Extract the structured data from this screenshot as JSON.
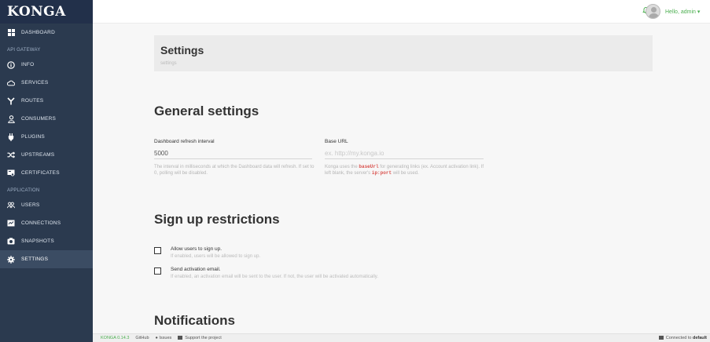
{
  "app": {
    "brand": "KONGA"
  },
  "topbar": {
    "user_label": "Hello, admin ▾"
  },
  "sidebar": {
    "dashboard": "DASHBOARD",
    "section_api": "API GATEWAY",
    "api_items": [
      {
        "label": "INFO",
        "icon": "info-circle-icon"
      },
      {
        "label": "SERVICES",
        "icon": "cloud-icon"
      },
      {
        "label": "ROUTES",
        "icon": "route-fork-icon"
      },
      {
        "label": "CONSUMERS",
        "icon": "user-icon"
      },
      {
        "label": "PLUGINS",
        "icon": "plug-icon"
      },
      {
        "label": "UPSTREAMS",
        "icon": "shuffle-icon"
      },
      {
        "label": "CERTIFICATES",
        "icon": "certificate-icon"
      }
    ],
    "section_app": "APPLICATION",
    "app_items": [
      {
        "label": "USERS",
        "icon": "users-icon"
      },
      {
        "label": "CONNECTIONS",
        "icon": "connection-icon"
      },
      {
        "label": "SNAPSHOTS",
        "icon": "camera-icon"
      },
      {
        "label": "SETTINGS",
        "icon": "gear-icon",
        "active": true
      }
    ]
  },
  "header": {
    "title": "Settings",
    "crumb": "settings"
  },
  "general": {
    "title": "General settings",
    "refresh_label": "Dashboard refresh interval",
    "refresh_value": "5000",
    "refresh_help": "The interval in milliseconds at which the Dashboard data will refresh. If set to 0, polling will be disabled.",
    "base_url_label": "Base URL",
    "base_url_placeholder": "ex. http://my.konga.io",
    "base_help_1": "Konga uses the ",
    "base_help_code_1": "baseUrl",
    "base_help_2": " for generating links (ex. Account activation link). If left blank, the server's ",
    "base_help_code_2": "ip:port",
    "base_help_3": " will be used."
  },
  "signup": {
    "title": "Sign up restrictions",
    "allow_label": "Allow users to sign up.",
    "allow_help": "If enabled, users will be allowed to sign up.",
    "activation_label": "Send activation email.",
    "activation_help": "If enabled, an activation email will be sent to the user. If not, the user will be activated automatically."
  },
  "notifications": {
    "title": "Notifications"
  },
  "footer": {
    "version": "KONGA 0.14.3",
    "github": "GitHub",
    "issues": "Issues",
    "support": "Support the project",
    "connected_prefix": "Connected to ",
    "connected_name": "default"
  },
  "colors": {
    "sidebar": "#2b3a4f",
    "accent": "#4caf50"
  }
}
